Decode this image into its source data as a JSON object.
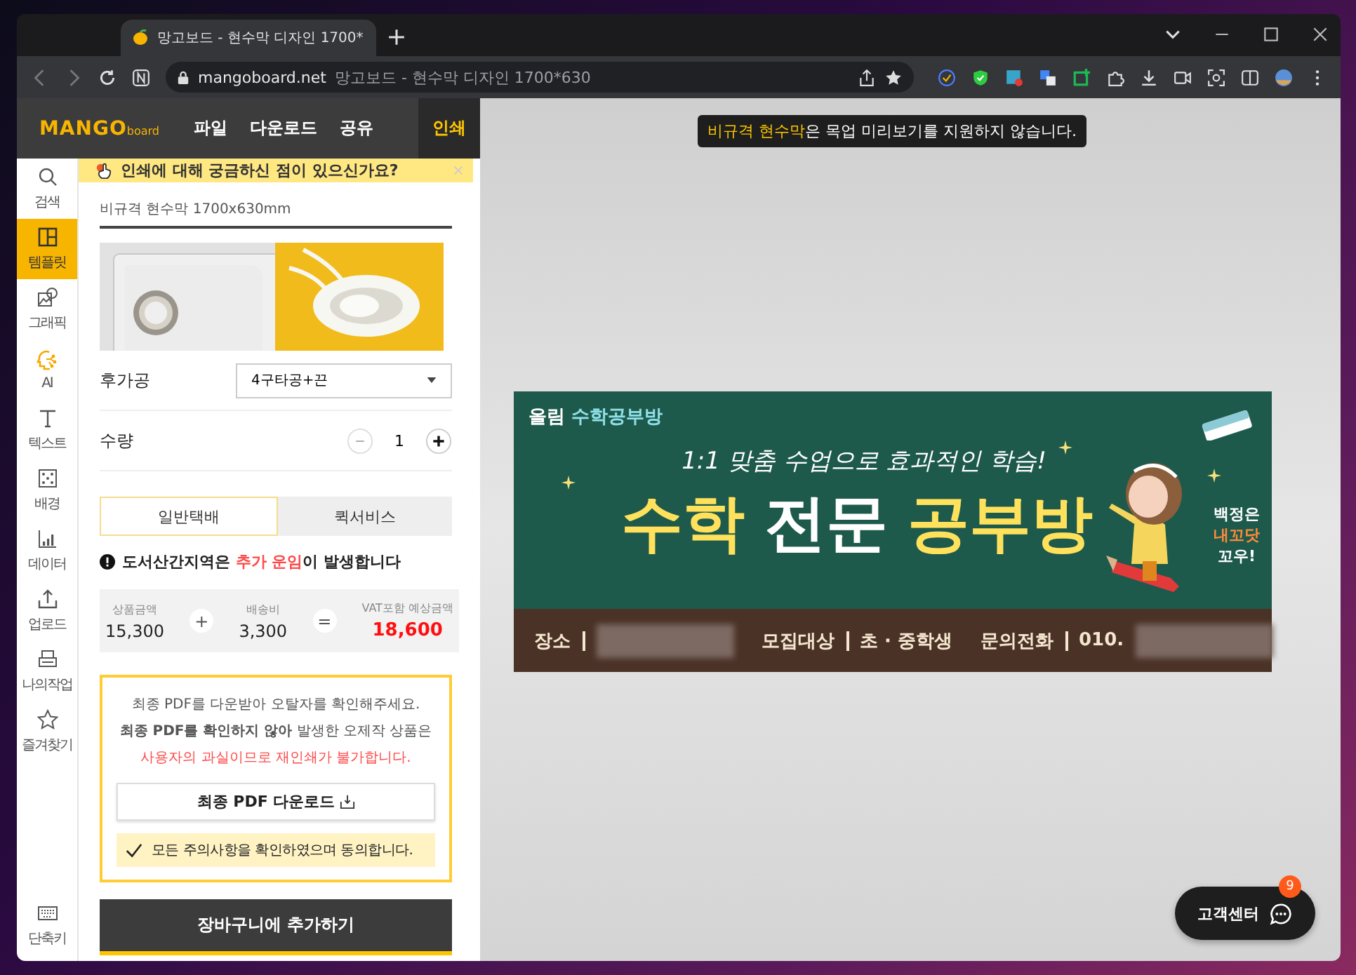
{
  "browser": {
    "tab_title": "망고보드 - 현수막 디자인 1700*",
    "url_domain": "mangoboard.net",
    "url_title": "망고보드 - 현수막 디자인 1700*630"
  },
  "app_menu": {
    "logo_main": "MANGO",
    "logo_sub": "board",
    "items": [
      {
        "label": "파일",
        "selected": false
      },
      {
        "label": "다운로드",
        "selected": false
      },
      {
        "label": "공유",
        "selected": false
      },
      {
        "label": "인쇄",
        "selected": true
      }
    ]
  },
  "sidebar": {
    "items": [
      {
        "label": "검색",
        "kind": "search",
        "selected": false
      },
      {
        "label": "템플릿",
        "kind": "template",
        "selected": true
      },
      {
        "label": "그래픽",
        "kind": "graphic",
        "selected": false
      },
      {
        "label": "AI",
        "kind": "ai",
        "selected": false
      },
      {
        "label": "텍스트",
        "kind": "text",
        "selected": false
      },
      {
        "label": "배경",
        "kind": "background",
        "selected": false
      },
      {
        "label": "데이터",
        "kind": "data",
        "selected": false
      },
      {
        "label": "업로드",
        "kind": "upload",
        "selected": false
      },
      {
        "label": "나의작업",
        "kind": "mywork",
        "selected": false
      },
      {
        "label": "즐겨찾기",
        "kind": "favorite",
        "selected": false
      }
    ],
    "shortcut": {
      "label": "단축키"
    }
  },
  "print_panel": {
    "help_banner": "인쇄에 대해 궁금하신 점이 있으신가요?",
    "product_name": "비규격 현수막 1700x630mm",
    "options": [
      {
        "label": "후가공",
        "kind": "select",
        "value": "4구타공+끈"
      },
      {
        "label": "수량",
        "kind": "stepper",
        "value": "1"
      }
    ],
    "delivery_tabs": [
      {
        "label": "일반택배",
        "selected": true
      },
      {
        "label": "퀵서비스",
        "selected": false
      }
    ],
    "notice_parts": [
      {
        "text": "도서산간지역은 ",
        "highlight": false
      },
      {
        "text": "추가 운임",
        "highlight": true
      },
      {
        "text": "이 발생합니다",
        "highlight": false
      }
    ],
    "prices": [
      {
        "label": "상품금액",
        "value": "15,300",
        "highlight": false
      },
      {
        "label": "배송비",
        "value": "3,300",
        "highlight": false
      },
      {
        "label": "VAT포함 예상금액",
        "value": "18,600",
        "highlight": true
      }
    ],
    "operators": [
      "+",
      "="
    ],
    "warning_lines": [
      {
        "text": "최종 PDF를 다운받아 오탈자를 확인해주세요.",
        "kind": "plain"
      },
      {
        "text": "**최종 PDF를 확인하지 않아** 발생한 오제작 상품은",
        "kind": "plain"
      },
      {
        "text": "사용자의 과실이므로 재인쇄가 불가합니다.",
        "kind": "alert"
      }
    ],
    "download_button": "최종 PDF 다운로드",
    "agreement": {
      "label": "모든 주의사항을 확인하였으며 동의합니다.",
      "checked": true
    },
    "cart_button": "장바구니에 추가하기"
  },
  "canvas": {
    "notice_parts": [
      {
        "text": "비규격 현수막",
        "highlight": true
      },
      {
        "text": "은 목업 미리보기를 지원하지 않습니다.",
        "highlight": false
      }
    ],
    "banner": {
      "brand": "올림",
      "brand_sub": "수학공부방",
      "tagline": "1:1 맞춤 수업으로 효과적인 학습!",
      "headline": [
        {
          "text": "수학",
          "highlight": true
        },
        {
          "text": "전문",
          "highlight": false
        },
        {
          "text": "공부방",
          "highlight": true
        }
      ],
      "side_lines": [
        {
          "text": "백정은",
          "kind": "plain"
        },
        {
          "text": "내꼬닷",
          "kind": "accent"
        },
        {
          "text": "꼬우!",
          "kind": "plain"
        }
      ],
      "footer": [
        {
          "label": "장소",
          "blurred": true
        },
        {
          "label": "모집대상",
          "value": "초 · 중학생",
          "blurred": false
        },
        {
          "label": "문의전화",
          "value": "010.",
          "blurred": true
        }
      ]
    },
    "help_button": {
      "label": "고객센터",
      "badge": "9"
    }
  }
}
